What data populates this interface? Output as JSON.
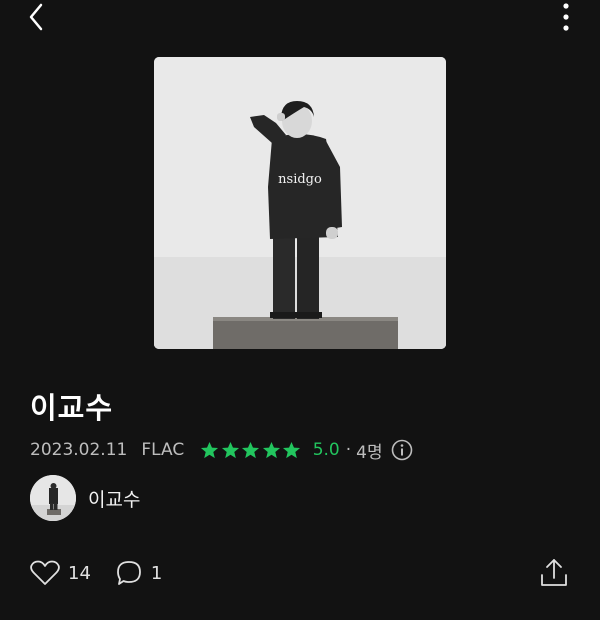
{
  "header": {
    "back_icon": "chevron-left-icon",
    "more_icon": "vertical-dots-icon"
  },
  "album": {
    "cover_text": "nsidgo",
    "title": "이교수",
    "release_date": "2023.02.11",
    "format": "FLAC",
    "rating": {
      "stars": 5,
      "max_stars": 5,
      "score": "5.0",
      "separator": "·",
      "count": "4명",
      "color": "#22c55e"
    }
  },
  "artist": {
    "name": "이교수"
  },
  "actions": {
    "likes": "14",
    "comments": "1",
    "like_icon": "heart-icon",
    "comment_icon": "comment-bubble-icon",
    "share_icon": "share-icon"
  },
  "colors": {
    "background": "#121212",
    "accent": "#22c55e"
  }
}
